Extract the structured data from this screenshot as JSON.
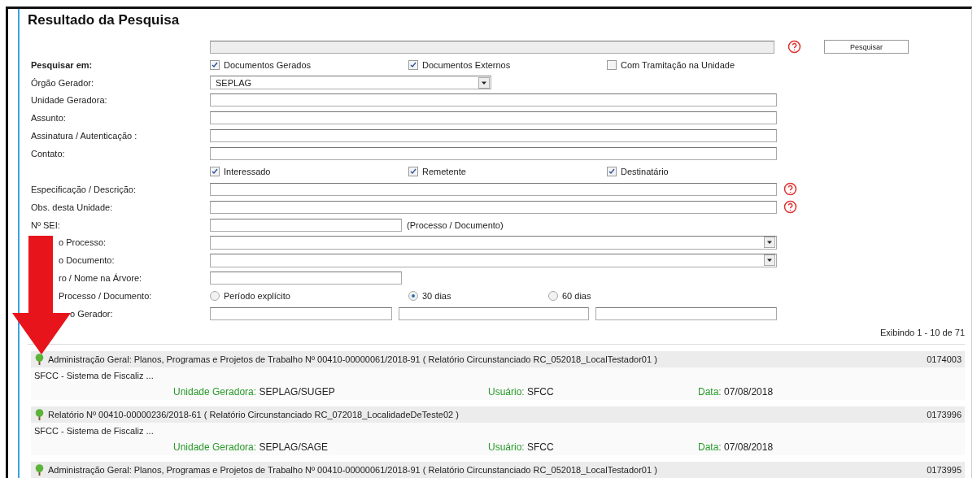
{
  "title": "Resultado da Pesquisa",
  "form": [
    {
      "kind": "search",
      "button": "Pesquisar",
      "help": true
    },
    {
      "kind": "checks",
      "label": "Pesquisar em:",
      "options": [
        {
          "label": "Documentos Gerados",
          "checked": true
        },
        {
          "label": "Documentos Externos",
          "checked": true
        },
        {
          "label": "Com Tramitação na Unidade",
          "checked": false
        }
      ]
    },
    {
      "kind": "select",
      "label": "Órgão Gerador:",
      "value": "SEPLAG"
    },
    {
      "kind": "text",
      "label": "Unidade Geradora:"
    },
    {
      "kind": "text",
      "label": "Assunto:"
    },
    {
      "kind": "text",
      "label": "Assinatura / Autenticação :"
    },
    {
      "kind": "text",
      "label": "Contato:"
    },
    {
      "kind": "checks",
      "options": [
        {
          "label": "Interessado",
          "checked": true
        },
        {
          "label": "Remetente",
          "checked": true
        },
        {
          "label": "Destinatário",
          "checked": true
        }
      ]
    },
    {
      "kind": "text",
      "label": "Especificação / Descrição:",
      "help": true
    },
    {
      "kind": "text",
      "label": "Obs. desta Unidade:",
      "help": true
    },
    {
      "kind": "short",
      "label": "Nº SEI:",
      "note": "(Processo / Documento)"
    },
    {
      "kind": "select-wide",
      "label": "o Processo:"
    },
    {
      "kind": "select-wide",
      "label": "o Documento:"
    },
    {
      "kind": "short",
      "label": "ro / Nome na Árvore:"
    },
    {
      "kind": "radios",
      "label": "Processo / Documento:",
      "options": [
        {
          "label": "Período explícito",
          "selected": false
        },
        {
          "label": "30 dias",
          "selected": true
        },
        {
          "label": "60 dias",
          "selected": false
        }
      ]
    },
    {
      "kind": "triple",
      "label": "o Gerador:"
    }
  ],
  "summary": "Exibindo 1 - 10 de 71",
  "results": [
    {
      "title": "Administração Geral: Planos, Programas e Projetos de Trabalho Nº 00410-00000061/2018-91 ( Relatório Circunstanciado RC_052018_LocalTestador01 )",
      "number": "0174003",
      "snippet": "SFCC - Sistema de Fiscaliz ...",
      "meta": [
        {
          "label": "Unidade Geradora:",
          "value": "SEPLAG/SUGEP"
        },
        {
          "label": "Usuário:",
          "value": "SFCC"
        },
        {
          "label": "Data:",
          "value": "07/08/2018"
        }
      ]
    },
    {
      "title": "Relatório Nº 00410-00000236/2018-61 ( Relatório Circunstanciado RC_072018_LocalidadeDeTeste02 )",
      "number": "0173996",
      "snippet": "SFCC - Sistema de Fiscaliz ...",
      "meta": [
        {
          "label": "Unidade Geradora:",
          "value": "SEPLAG/SAGE"
        },
        {
          "label": "Usuário:",
          "value": "SFCC"
        },
        {
          "label": "Data:",
          "value": "07/08/2018"
        }
      ]
    },
    {
      "title": "Administração Geral: Planos, Programas e Projetos de Trabalho Nº 00410-00000061/2018-91 ( Relatório Circunstanciado RC_052018_LocalTestador01 )",
      "number": "0173995"
    }
  ],
  "annotation": {
    "kind": "arrow"
  }
}
